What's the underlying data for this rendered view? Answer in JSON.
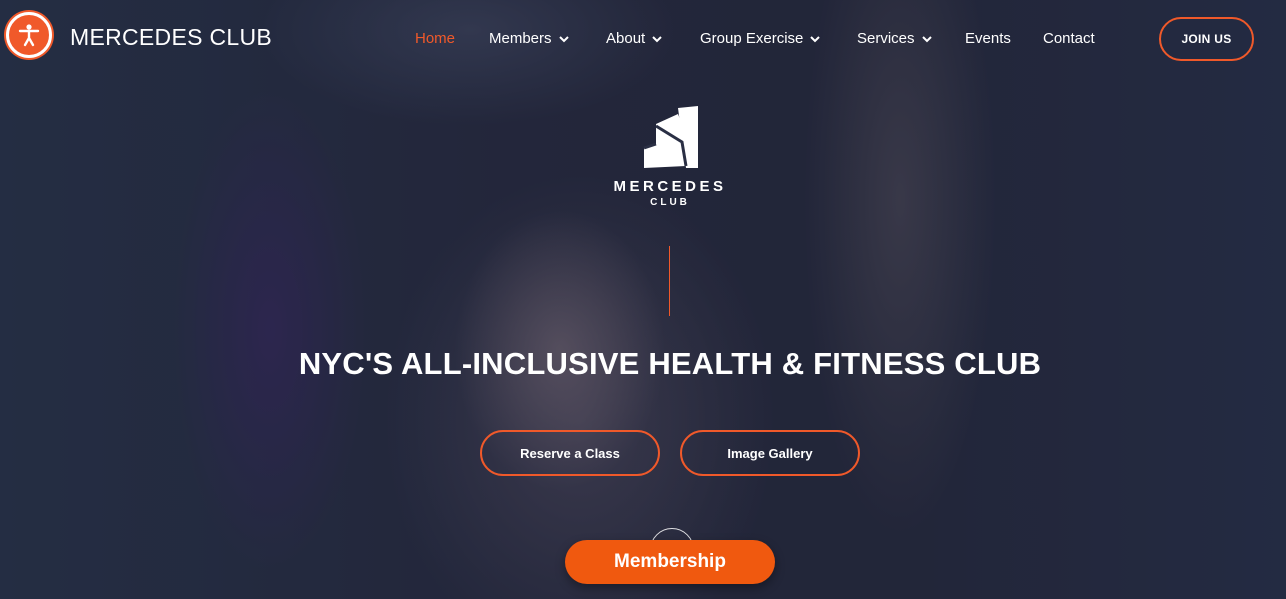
{
  "header": {
    "brand": "MERCEDES CLUB",
    "accessibility_icon": "accessibility-person-icon",
    "nav": [
      {
        "label": "Home",
        "active": true,
        "dropdown": false
      },
      {
        "label": "Members",
        "active": false,
        "dropdown": true
      },
      {
        "label": "About",
        "active": false,
        "dropdown": true
      },
      {
        "label": "Group Exercise",
        "active": false,
        "dropdown": true
      },
      {
        "label": "Services",
        "active": false,
        "dropdown": true
      },
      {
        "label": "Events",
        "active": false,
        "dropdown": false
      },
      {
        "label": "Contact",
        "active": false,
        "dropdown": false
      }
    ],
    "join_label": "JOIN US"
  },
  "hero": {
    "logo_name": "MERCEDES",
    "logo_sub": "CLUB",
    "headline": "NYC'S ALL-INCLUSIVE HEALTH & FITNESS CLUB",
    "reserve_label": "Reserve a Class",
    "gallery_label": "Image Gallery",
    "membership_label": "Membership"
  },
  "colors": {
    "accent": "#f0592a",
    "membership_bg": "#f0590f"
  }
}
